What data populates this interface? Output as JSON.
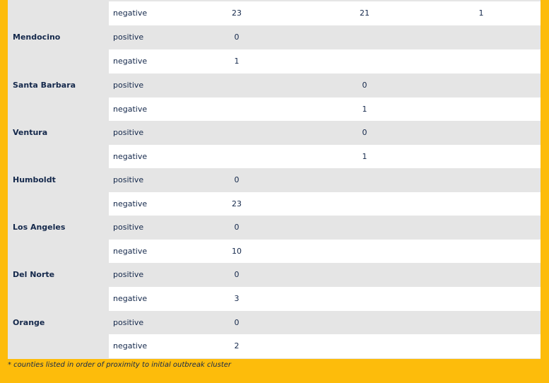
{
  "table": {
    "rows": [
      {
        "county": "",
        "result": "negative",
        "c1": "23",
        "c2": "21",
        "c3": "1"
      },
      {
        "county": "Mendocino",
        "result": "positive",
        "c1": "0",
        "c2": "",
        "c3": ""
      },
      {
        "county": "",
        "result": "negative",
        "c1": "1",
        "c2": "",
        "c3": ""
      },
      {
        "county": "Santa Barbara",
        "result": "positive",
        "c1": "",
        "c2": "0",
        "c3": ""
      },
      {
        "county": "",
        "result": "negative",
        "c1": "",
        "c2": "1",
        "c3": ""
      },
      {
        "county": "Ventura",
        "result": "positive",
        "c1": "",
        "c2": "0",
        "c3": ""
      },
      {
        "county": "",
        "result": "negative",
        "c1": "",
        "c2": "1",
        "c3": ""
      },
      {
        "county": "Humboldt",
        "result": "positive",
        "c1": "0",
        "c2": "",
        "c3": ""
      },
      {
        "county": "",
        "result": "negative",
        "c1": "23",
        "c2": "",
        "c3": ""
      },
      {
        "county": "Los Angeles",
        "result": "positive",
        "c1": "0",
        "c2": "",
        "c3": ""
      },
      {
        "county": "",
        "result": "negative",
        "c1": "10",
        "c2": "",
        "c3": ""
      },
      {
        "county": "Del Norte",
        "result": "positive",
        "c1": "0",
        "c2": "",
        "c3": ""
      },
      {
        "county": "",
        "result": "negative",
        "c1": "3",
        "c2": "",
        "c3": ""
      },
      {
        "county": "Orange",
        "result": "positive",
        "c1": "0",
        "c2": "",
        "c3": ""
      },
      {
        "county": "",
        "result": "negative",
        "c1": "2",
        "c2": "",
        "c3": ""
      }
    ]
  },
  "footnote": "* counties listed in order of proximity to initial outbreak cluster",
  "colors": {
    "frame": "#fdbc0b",
    "text": "#14284b",
    "row_alt": "#e5e5e5",
    "row": "#ffffff"
  }
}
